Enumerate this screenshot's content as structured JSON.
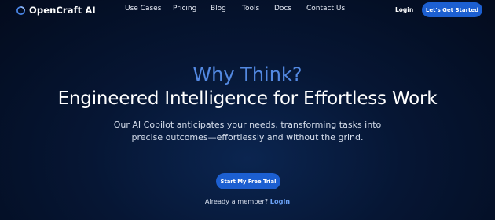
{
  "brand": {
    "name": "OpenCraft AI",
    "icon": "ring-logo-icon",
    "accent": "#4a86e8"
  },
  "nav": {
    "links": [
      "Use Cases",
      "Pricing",
      "Blog",
      "Tools",
      "Docs",
      "Contact Us"
    ],
    "login": "Login",
    "cta": "Let's Get Started"
  },
  "hero": {
    "kicker": "Why Think?",
    "title": "Engineered Intelligence for Effortless Work",
    "subtitle": "Our AI Copilot anticipates your needs, transforming tasks into precise outcomes—effortlessly and without the grind.",
    "trial_button": "Start My Free Trial",
    "member_prompt": "Already a member?",
    "member_login": "Login"
  },
  "colors": {
    "background": "#061634",
    "button": "#1c5fd1",
    "kicker": "#5389e2",
    "link": "#6aa1f5"
  }
}
